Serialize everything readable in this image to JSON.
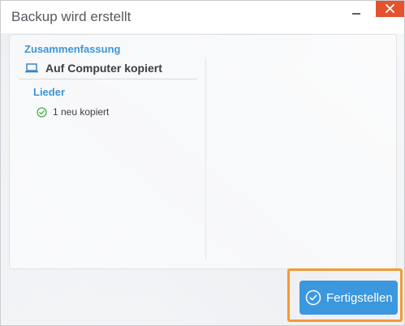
{
  "window": {
    "title": "Backup wird erstellt"
  },
  "summary": {
    "legend": "Zusammenfassung",
    "section_title": "Auf Computer kopiert",
    "section_icon": "laptop-icon",
    "category": "Lieder",
    "items": [
      {
        "icon": "check-circle-icon",
        "text": "1 neu kopiert"
      }
    ]
  },
  "footer": {
    "finish_label": "Fertigstellen",
    "finish_icon": "check-circle-icon"
  },
  "colors": {
    "accent": "#3b96d8",
    "close_button": "#e5532d",
    "highlight": "#f39a33",
    "success": "#4caf50"
  }
}
